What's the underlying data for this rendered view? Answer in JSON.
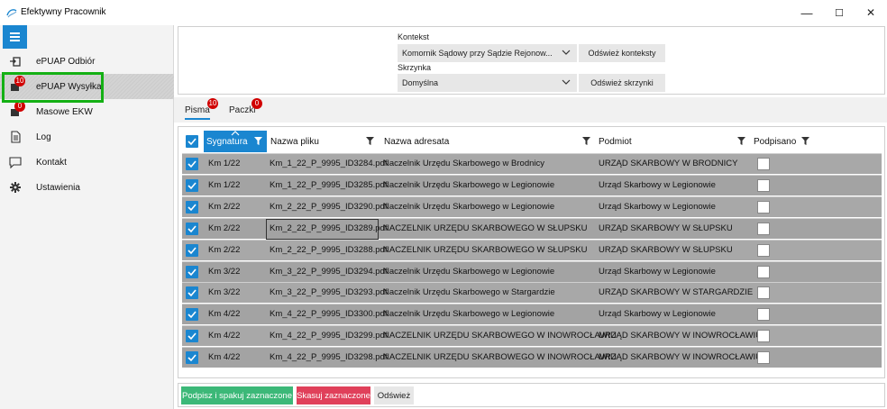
{
  "window": {
    "title": "Efektywny Pracownik",
    "minimize": "—",
    "maximize": "☐",
    "close": "✕"
  },
  "sidebar": {
    "items": [
      {
        "label": "ePUAP Odbiór",
        "icon": "inbox-import-icon",
        "badge": null
      },
      {
        "label": "ePUAP Wysyłka",
        "icon": "outbox-send-icon",
        "badge": "10"
      },
      {
        "label": "Masowe EKW",
        "icon": "bulk-ekw-icon",
        "badge": "0"
      },
      {
        "label": "Log",
        "icon": "document-log-icon",
        "badge": null
      },
      {
        "label": "Kontakt",
        "icon": "chat-bubble-icon",
        "badge": null
      },
      {
        "label": "Ustawienia",
        "icon": "gear-icon",
        "badge": null
      }
    ]
  },
  "context": {
    "kontekst_label": "Kontekst",
    "kontekst_value": "Komornik Sądowy przy Sądzie Rejonow...",
    "refresh_contexts": "Odśwież konteksty",
    "skrzynka_label": "Skrzynka",
    "skrzynka_value": "Domyślna",
    "refresh_boxes": "Odśwież skrzynki"
  },
  "tabs": [
    {
      "label": "Pisma",
      "badge": "10"
    },
    {
      "label": "Paczki",
      "badge": "0"
    }
  ],
  "grid": {
    "columns": [
      "Sygnatura",
      "Nazwa pliku",
      "Nazwa adresata",
      "Podmiot",
      "Podpisano"
    ],
    "rows": [
      {
        "sygnatura": "Km 1/22",
        "plik": "Km_1_22_P_9995_ID3284.pdf",
        "adresat": "Naczelnik Urzędu Skarbowego w Brodnicy",
        "podmiot": "URZĄD SKARBOWY W BRODNICY"
      },
      {
        "sygnatura": "Km 1/22",
        "plik": "Km_1_22_P_9995_ID3285.pdf",
        "adresat": "Naczelnik Urzędu Skarbowego w Legionowie",
        "podmiot": "Urząd Skarbowy w Legionowie"
      },
      {
        "sygnatura": "Km 2/22",
        "plik": "Km_2_22_P_9995_ID3290.pdf",
        "adresat": "Naczelnik Urzędu Skarbowego w Legionowie",
        "podmiot": "Urząd Skarbowy w Legionowie"
      },
      {
        "sygnatura": "Km 2/22",
        "plik": "Km_2_22_P_9995_ID3289.pdf",
        "adresat": "NACZELNIK URZĘDU SKARBOWEGO W SŁUPSKU",
        "podmiot": "URZĄD SKARBOWY W SŁUPSKU"
      },
      {
        "sygnatura": "Km 2/22",
        "plik": "Km_2_22_P_9995_ID3288.pdf",
        "adresat": "NACZELNIK URZĘDU SKARBOWEGO W SŁUPSKU",
        "podmiot": "URZĄD SKARBOWY W SŁUPSKU"
      },
      {
        "sygnatura": "Km 3/22",
        "plik": "Km_3_22_P_9995_ID3294.pdf",
        "adresat": "Naczelnik Urzędu Skarbowego w Legionowie",
        "podmiot": "Urząd Skarbowy w Legionowie"
      },
      {
        "sygnatura": "Km 3/22",
        "plik": "Km_3_22_P_9995_ID3293.pdf",
        "adresat": "Naczelnik Urzędu Skarbowego w Stargardzie",
        "podmiot": "URZĄD SKARBOWY W STARGARDZIE"
      },
      {
        "sygnatura": "Km 4/22",
        "plik": "Km_4_22_P_9995_ID3300.pdf",
        "adresat": "Naczelnik Urzędu Skarbowego w Legionowie",
        "podmiot": "Urząd Skarbowy w Legionowie"
      },
      {
        "sygnatura": "Km 4/22",
        "plik": "Km_4_22_P_9995_ID3299.pdf",
        "adresat": "NACZELNIK URZĘDU SKARBOWEGO W INOWROCŁAWIU",
        "podmiot": "URZĄD SKARBOWY W INOWROCŁAWIU"
      },
      {
        "sygnatura": "Km 4/22",
        "plik": "Km_4_22_P_9995_ID3298.pdf",
        "adresat": "NACZELNIK URZĘDU SKARBOWEGO W INOWROCŁAWIU",
        "podmiot": "URZĄD SKARBOWY W INOWROCŁAWIU"
      }
    ]
  },
  "actions": {
    "sign_pack": "Podpisz i spakuj zaznaczone",
    "delete_selected": "Skasuj zaznaczone",
    "refresh": "Odśwież"
  },
  "colors": {
    "accent": "#1a86d0",
    "badge": "#d10000",
    "highlight": "#14b014",
    "sign_button": "#3cb878",
    "delete_button": "#e0405a"
  }
}
